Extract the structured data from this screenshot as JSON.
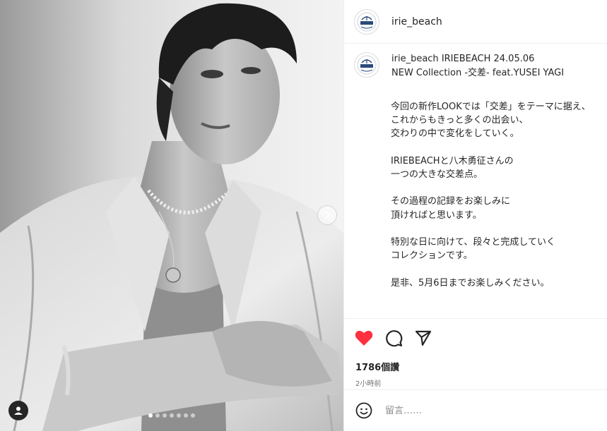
{
  "account": {
    "username": "irie_beach",
    "avatar_icon": "iriebeach-logo-icon",
    "avatar_logo_text": "IRIE BEACH"
  },
  "caption": {
    "username": "irie_beach",
    "headline_line1": "IRIEBEACH 24.05.06",
    "headline_line2": "NEW Collection -交差- feat.YUSEI YAGI",
    "body": "今回の新作LOOKでは「交差」をテーマに据え、\nこれからもきっと多くの出会い、\n交わりの中で変化をしていく。\n\nIRIEBEACHと八木勇征さんの\n一つの大きな交差点。\n\nその過程の記録をお楽しみに\n頂ければと思います。\n\n特別な日に向けて、段々と完成していく\nコレクションです。\n\n是非、5月6日までお楽しみください。"
  },
  "stats": {
    "likes": "1786個讚",
    "time": "2小時前"
  },
  "comment": {
    "placeholder": "留言……"
  },
  "media": {
    "description_icon": "black-and-white-portrait-photo",
    "carousel_dots": 7,
    "carousel_active_index": 0
  },
  "colors": {
    "like_heart": "#ff3040",
    "text": "#262626",
    "secondary_text": "#737373",
    "divider": "#efefef"
  }
}
